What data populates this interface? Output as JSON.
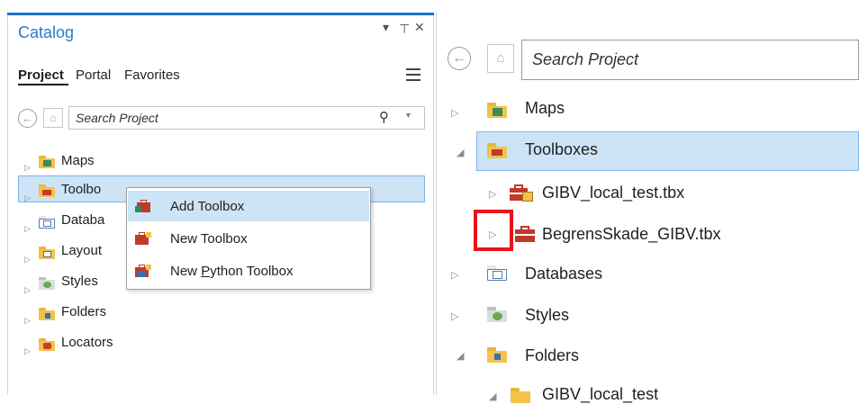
{
  "left_panel": {
    "title": "Catalog",
    "title_controls": [
      "▾",
      "⊥",
      "✕"
    ],
    "tabs": [
      {
        "label": "Project",
        "selected": true
      },
      {
        "label": "Portal",
        "selected": false
      },
      {
        "label": "Favorites",
        "selected": false
      }
    ],
    "search": {
      "placeholder": "Search Project"
    },
    "tree": [
      {
        "label": "Maps",
        "icon": "maps-folder-icon",
        "expanded": false
      },
      {
        "label": "Toolbo",
        "icon": "toolboxes-folder-icon",
        "expanded": false,
        "selected": true
      },
      {
        "label": "Databa",
        "icon": "databases-folder-icon",
        "expanded": false
      },
      {
        "label": "Layout",
        "icon": "layouts-folder-icon",
        "expanded": false
      },
      {
        "label": "Styles",
        "icon": "styles-folder-icon",
        "expanded": false
      },
      {
        "label": "Folders",
        "icon": "folders-folder-icon",
        "expanded": false
      },
      {
        "label": "Locators",
        "icon": "locators-folder-icon",
        "expanded": false
      }
    ]
  },
  "context_menu": {
    "items": [
      {
        "label": "Add Toolbox",
        "icon": "add-toolbox-icon",
        "highlighted": true
      },
      {
        "label": "New Toolbox",
        "icon": "new-toolbox-icon",
        "highlighted": false
      },
      {
        "label_pre": "New ",
        "label_mnemonic": "P",
        "label_post": "ython Toolbox",
        "icon": "new-python-toolbox-icon",
        "highlighted": false
      }
    ]
  },
  "right_panel": {
    "search": {
      "placeholder": "Search Project"
    },
    "tree": [
      {
        "label": "Maps",
        "expanded": false
      },
      {
        "label": "Toolboxes",
        "expanded": true,
        "selected": true
      },
      {
        "label": "GIBV_local_test.tbx",
        "expanded": false
      },
      {
        "label": "BegrensSkade_GIBV.tbx",
        "expanded": false,
        "highlighted_expander": true
      },
      {
        "label": "Databases",
        "expanded": false
      },
      {
        "label": "Styles",
        "expanded": false
      },
      {
        "label": "Folders",
        "expanded": true
      },
      {
        "label": "GIBV_local_test",
        "expanded": true
      }
    ]
  },
  "colors": {
    "accent_blue": "#1a73c8",
    "title_blue": "#2b7ac9",
    "selection_fill": "#cde4f7",
    "selection_border": "#7eb4ea",
    "folder_yellow": "#f2c24a",
    "toolbox_red": "#c0392b",
    "highlight_red": "#e8141b"
  }
}
